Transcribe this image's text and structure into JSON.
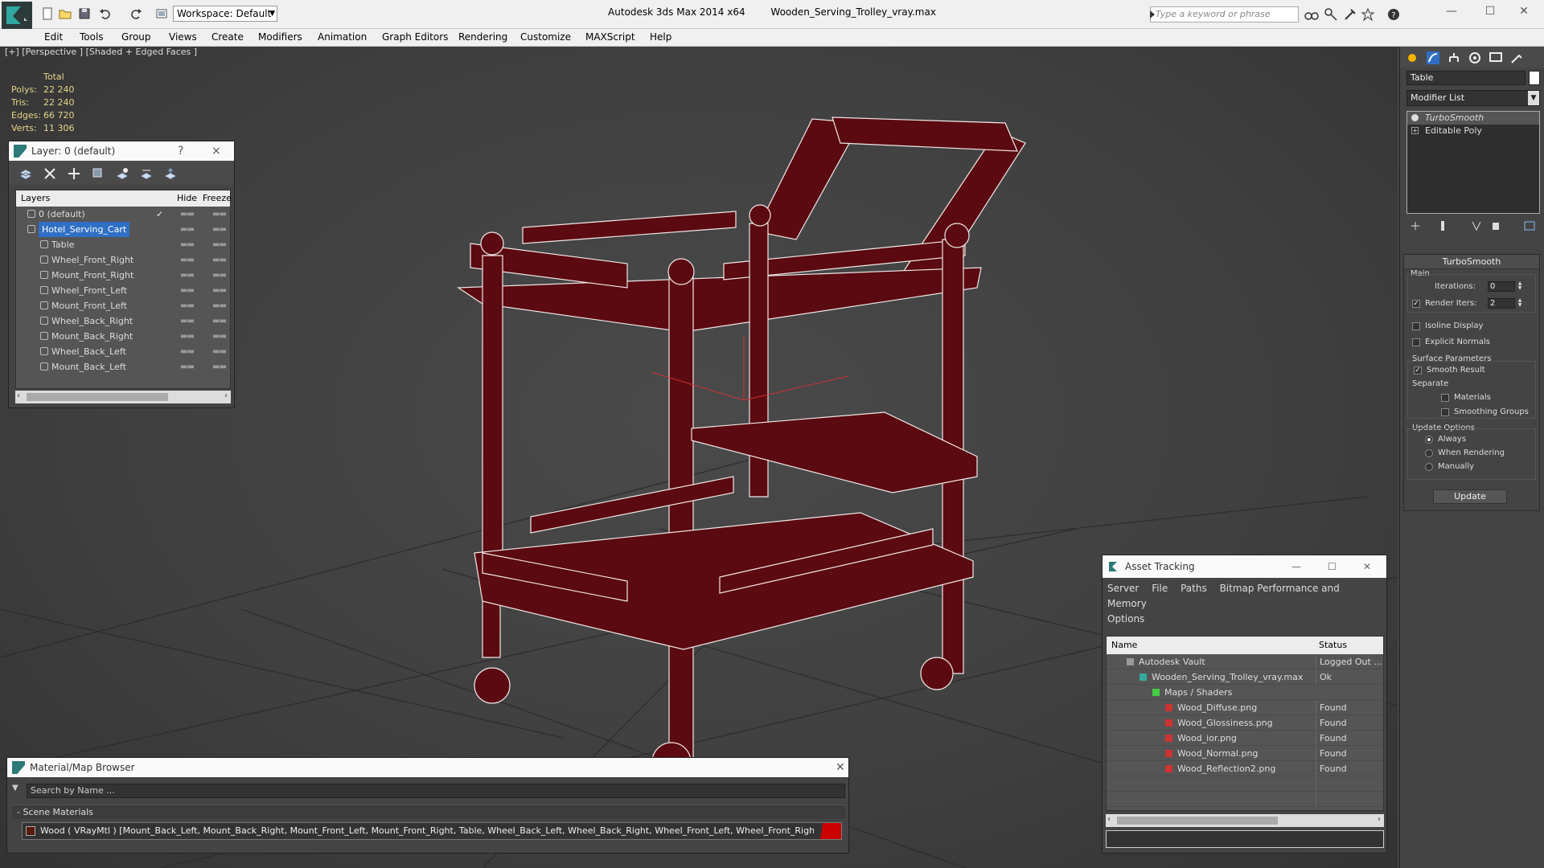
{
  "titlebar": {
    "workspace": "Workspace: Default",
    "app_name": "Autodesk 3ds Max  2014 x64",
    "file_name": "Wooden_Serving_Trolley_vray.max",
    "search_placeholder": "Type a keyword or phrase"
  },
  "menu": [
    "Edit",
    "Tools",
    "Group",
    "Views",
    "Create",
    "Modifiers",
    "Animation",
    "Graph Editors",
    "Rendering",
    "Customize",
    "MAXScript",
    "Help"
  ],
  "viewport": {
    "label": "[+] [Perspective ] [Shaded + Edged Faces ]",
    "stats": {
      "header": "Total",
      "rows": [
        {
          "k": "Polys:",
          "v": "22 240"
        },
        {
          "k": "Tris:",
          "v": "22 240"
        },
        {
          "k": "Edges:",
          "v": "66 720"
        },
        {
          "k": "Verts:",
          "v": "11 306"
        }
      ]
    },
    "colors": {
      "model": "#5a0a10",
      "wire": "#f2e8e8",
      "grid": "#2b2b2b"
    }
  },
  "layers": {
    "title": "Layer: 0 (default)",
    "help": "?",
    "close": "×",
    "columns": {
      "name": "Layers",
      "hide": "Hide",
      "freeze": "Freeze"
    },
    "items": [
      {
        "name": "0 (default)",
        "level": 0,
        "checked": true
      },
      {
        "name": "Hotel_Serving_Cart",
        "level": 0,
        "selected": true
      },
      {
        "name": "Table",
        "level": 1
      },
      {
        "name": "Wheel_Front_Right",
        "level": 1
      },
      {
        "name": "Mount_Front_Right",
        "level": 1
      },
      {
        "name": "Wheel_Front_Left",
        "level": 1
      },
      {
        "name": "Mount_Front_Left",
        "level": 1
      },
      {
        "name": "Wheel_Back_Right",
        "level": 1
      },
      {
        "name": "Mount_Back_Right",
        "level": 1
      },
      {
        "name": "Wheel_Back_Left",
        "level": 1
      },
      {
        "name": "Mount_Back_Left",
        "level": 1
      }
    ],
    "dots": "▬▬"
  },
  "material_browser": {
    "title": "Material/Map Browser",
    "search": "Search by Name ...",
    "group": "- Scene Materials",
    "material": "Wood  ( VRayMtl ) [Mount_Back_Left, Mount_Back_Right, Mount_Front_Left, Mount_Front_Right, Table, Wheel_Back_Left, Wheel_Back_Right, Wheel_Front_Left, Wheel_Front_Right]"
  },
  "asset_tracking": {
    "title": "Asset Tracking",
    "menu": [
      "Server",
      "File",
      "Paths",
      "Bitmap Performance and Memory"
    ],
    "menu2": "Options",
    "columns": {
      "name": "Name",
      "status": "Status"
    },
    "rows": [
      {
        "name": "Autodesk Vault",
        "status": "Logged Out ...",
        "level": 0,
        "icon": "vault"
      },
      {
        "name": "Wooden_Serving_Trolley_vray.max",
        "status": "Ok",
        "level": 1,
        "icon": "max"
      },
      {
        "name": "Maps / Shaders",
        "status": "",
        "level": 2,
        "icon": "maps"
      },
      {
        "name": "Wood_Diffuse.png",
        "status": "Found",
        "level": 3,
        "icon": "png"
      },
      {
        "name": "Wood_Glossiness.png",
        "status": "Found",
        "level": 3,
        "icon": "png"
      },
      {
        "name": "Wood_ior.png",
        "status": "Found",
        "level": 3,
        "icon": "png"
      },
      {
        "name": "Wood_Normal.png",
        "status": "Found",
        "level": 3,
        "icon": "png"
      },
      {
        "name": "Wood_Reflection2.png",
        "status": "Found",
        "level": 3,
        "icon": "png"
      }
    ]
  },
  "command_panel": {
    "object_name": "Table",
    "modifier_list": "Modifier List",
    "stack": [
      "TurboSmooth",
      "Editable Poly"
    ],
    "rollout_title": "TurboSmooth",
    "main_label": "Main",
    "iterations_label": "Iterations:",
    "iterations_value": "0",
    "render_iters_label": "Render Iters:",
    "render_iters_value": "2",
    "render_iters_checked": true,
    "isoline": "Isoline Display",
    "explicit_normals": "Explicit Normals",
    "surface_params": "Surface Parameters",
    "smooth_result": "Smooth Result",
    "separate": "Separate",
    "materials": "Materials",
    "smoothing_groups": "Smoothing Groups",
    "update_options": "Update Options",
    "always": "Always",
    "when_rendering": "When Rendering",
    "manually": "Manually",
    "update_button": "Update"
  }
}
